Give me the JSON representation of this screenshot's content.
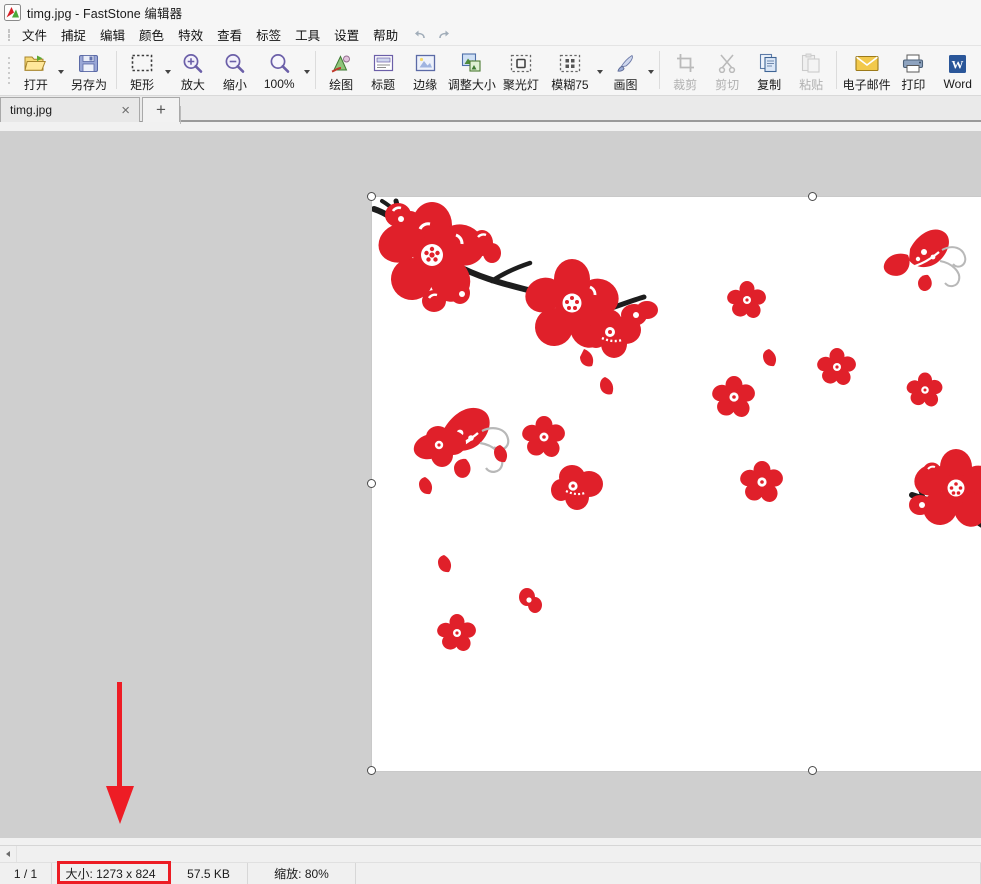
{
  "window": {
    "title": "timg.jpg - FastStone 编辑器",
    "app_icon": "faststone-logo-icon"
  },
  "menubar": {
    "items": [
      {
        "label": "文件",
        "name": "menu-file"
      },
      {
        "label": "捕捉",
        "name": "menu-capture"
      },
      {
        "label": "编辑",
        "name": "menu-edit"
      },
      {
        "label": "颜色",
        "name": "menu-color"
      },
      {
        "label": "特效",
        "name": "menu-effects"
      },
      {
        "label": "查看",
        "name": "menu-view"
      },
      {
        "label": "标签",
        "name": "menu-tags"
      },
      {
        "label": "工具",
        "name": "menu-tools"
      },
      {
        "label": "设置",
        "name": "menu-settings"
      },
      {
        "label": "帮助",
        "name": "menu-help"
      }
    ],
    "undo_icon": "undo-icon",
    "redo_icon": "redo-icon"
  },
  "toolbar": {
    "buttons": [
      {
        "label": "打开",
        "name": "toolbar-open",
        "icon": "open-folder-icon",
        "disabled": false,
        "caret": true
      },
      {
        "label": "另存为",
        "name": "toolbar-save-as",
        "icon": "floppy-disk-icon",
        "disabled": false,
        "caret": false
      },
      {
        "label": "矩形",
        "name": "toolbar-rectangle",
        "icon": "marquee-icon",
        "disabled": false,
        "caret": true
      },
      {
        "label": "放大",
        "name": "toolbar-zoom-in",
        "icon": "magnifier-plus-icon",
        "disabled": false,
        "caret": false
      },
      {
        "label": "缩小",
        "name": "toolbar-zoom-out",
        "icon": "magnifier-minus-icon",
        "disabled": false,
        "caret": false
      },
      {
        "label": "100%",
        "name": "toolbar-zoom-100",
        "icon": "magnifier-icon",
        "disabled": false,
        "caret": true
      },
      {
        "label": "绘图",
        "name": "toolbar-draw",
        "icon": "draw-brush-icon",
        "disabled": false,
        "caret": false
      },
      {
        "label": "标题",
        "name": "toolbar-caption",
        "icon": "caption-icon",
        "disabled": false,
        "caret": false
      },
      {
        "label": "边缘",
        "name": "toolbar-border",
        "icon": "border-icon",
        "disabled": false,
        "caret": false
      },
      {
        "label": "调整大小",
        "name": "toolbar-resize",
        "icon": "resize-icon",
        "disabled": false,
        "caret": false
      },
      {
        "label": "聚光灯",
        "name": "toolbar-spotlight",
        "icon": "spotlight-icon",
        "disabled": false,
        "caret": false
      },
      {
        "label": "模糊75",
        "name": "toolbar-blur",
        "icon": "blur-icon",
        "disabled": false,
        "caret": true
      },
      {
        "label": "画图",
        "name": "toolbar-paint",
        "icon": "paint-icon",
        "disabled": false,
        "caret": true
      },
      {
        "label": "裁剪",
        "name": "toolbar-crop",
        "icon": "crop-icon",
        "disabled": true,
        "caret": false
      },
      {
        "label": "剪切",
        "name": "toolbar-cut",
        "icon": "scissors-icon",
        "disabled": true,
        "caret": false
      },
      {
        "label": "复制",
        "name": "toolbar-copy",
        "icon": "copy-icon",
        "disabled": false,
        "caret": false
      },
      {
        "label": "粘贴",
        "name": "toolbar-paste",
        "icon": "paste-icon",
        "disabled": true,
        "caret": false
      },
      {
        "label": "电子邮件",
        "name": "toolbar-email",
        "icon": "envelope-icon",
        "disabled": false,
        "caret": false
      },
      {
        "label": "打印",
        "name": "toolbar-print",
        "icon": "printer-icon",
        "disabled": false,
        "caret": false
      },
      {
        "label": "Word",
        "name": "toolbar-word",
        "icon": "word-icon",
        "disabled": false,
        "caret": false
      }
    ]
  },
  "tabbar": {
    "tabs": [
      {
        "label": "timg.jpg",
        "name": "tab-timg-jpg",
        "close_glyph": "×"
      }
    ],
    "new_tab_glyph": "+"
  },
  "statusbar": {
    "pages": "1 / 1",
    "size": "大小: 1273 x 824",
    "filesize": "57.5 KB",
    "zoom": "缩放: 80%"
  },
  "annotations": {
    "arrow": {
      "name": "red-down-arrow-annotation",
      "color": "#ec1c24"
    },
    "highlight_rect": {
      "name": "red-highlight-rectangle-annotation",
      "color": "#ec1c24"
    }
  },
  "image": {
    "name": "plum-blossom-butterfly-artwork",
    "alt": "红色梅花与蝴蝶图案",
    "colors": {
      "flower": "#e0202a",
      "flower_dark": "#c5121c",
      "branch": "#1d1d1d",
      "background": "#ffffff"
    }
  }
}
